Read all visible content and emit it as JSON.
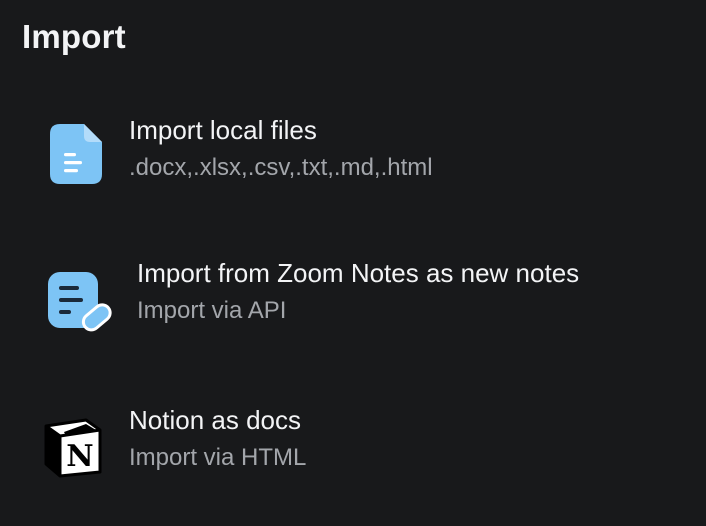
{
  "header": {
    "title": "Import"
  },
  "items": [
    {
      "icon": "document-icon",
      "label": "Import local files",
      "sub": ".docx,.xlsx,.csv,.txt,.md,.html"
    },
    {
      "icon": "note-edit-icon",
      "label": "Import from Zoom Notes as new notes",
      "sub": "Import via API"
    },
    {
      "icon": "notion-logo-icon",
      "label": "Notion as docs",
      "sub": "Import via HTML"
    }
  ],
  "colors": {
    "background": "#18191b",
    "text_primary": "#f3f4f6",
    "text_secondary": "#a3a6ab",
    "icon_blue": "#7dc4f5"
  }
}
